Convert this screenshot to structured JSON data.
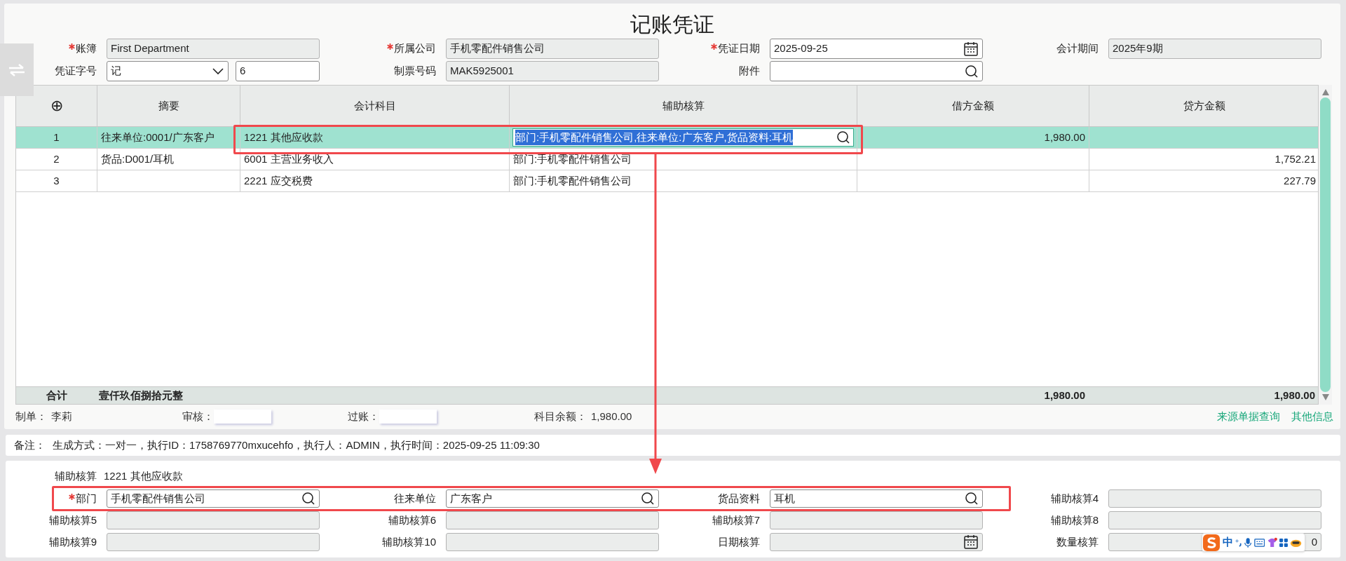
{
  "window": {
    "title": "记账凭证"
  },
  "header_fields": [
    {
      "label": "账簿",
      "required": true,
      "kind": "text",
      "readonly": true,
      "value": "First Department"
    },
    {
      "label": "所属公司",
      "required": true,
      "kind": "text",
      "readonly": true,
      "value": "手机零配件销售公司"
    },
    {
      "label": "凭证日期",
      "required": true,
      "kind": "date",
      "readonly": false,
      "value": "2025-09-25"
    },
    {
      "label": "会计期间",
      "required": false,
      "kind": "text",
      "readonly": true,
      "value": "2025年9期"
    },
    {
      "label": "凭证字号",
      "required": false,
      "kind": "select_pair",
      "readonly": false,
      "value": "记",
      "second_value": "6"
    },
    {
      "label": "制票号码",
      "required": false,
      "kind": "text",
      "readonly": true,
      "value": "MAK5925001"
    },
    {
      "label": "附件",
      "required": false,
      "kind": "lookup",
      "readonly": false
    }
  ],
  "table": {
    "add_column": "⊕",
    "columns": [
      "摘要",
      "会计科目",
      "辅助核算",
      "借方金额",
      "贷方金额"
    ],
    "rows": [
      {
        "index": "1",
        "selected": true,
        "summary": "往来单位:0001/广东客户",
        "account": "1221 其他应收款",
        "auxiliary": "部门:手机零配件销售公司,往来单位:广东客户,货品资料:耳机",
        "debit": "1,980.00"
      },
      {
        "index": "2",
        "selected": false,
        "summary": "货品:D001/耳机",
        "account": "6001 主营业务收入",
        "auxiliary": "部门:手机零配件销售公司",
        "credit": "1,752.21"
      },
      {
        "index": "3",
        "selected": false,
        "account": "2221 应交税费",
        "auxiliary": "部门:手机零配件销售公司",
        "credit": "227.79"
      }
    ],
    "total": {
      "label": "合计",
      "amount_in_words": "壹仟玖佰捌拾元整",
      "debit": "1,980.00",
      "credit": "1,980.00"
    }
  },
  "footer": {
    "maker_label": "制单：",
    "maker": "李莉",
    "reviewer_label": "审核：",
    "posting_label": "过账：",
    "balance_label": "科目余额：",
    "balance": "1,980.00",
    "links": [
      "来源单据查询",
      "其他信息"
    ]
  },
  "remark": {
    "label": "备注：",
    "text": "生成方式：一对一，执行ID：1758769770mxucehfo，执行人：ADMIN，执行时间：2025-09-25 11:09:30"
  },
  "auxiliary_panel": {
    "label": "辅助核算",
    "account": "1221 其他应收款",
    "fields": [
      {
        "label": "部门",
        "required": true,
        "kind": "lookup",
        "readonly": false,
        "value": "手机零配件销售公司"
      },
      {
        "label": "往来单位",
        "required": false,
        "kind": "lookup",
        "readonly": false,
        "value": "广东客户"
      },
      {
        "label": "货品资料",
        "required": false,
        "kind": "lookup",
        "readonly": false,
        "value": "耳机"
      },
      {
        "label": "辅助核算4",
        "required": false,
        "kind": "text",
        "readonly": true
      },
      {
        "label": "辅助核算5",
        "required": false,
        "kind": "text",
        "readonly": true
      },
      {
        "label": "辅助核算6",
        "required": false,
        "kind": "text",
        "readonly": true
      },
      {
        "label": "辅助核算7",
        "required": false,
        "kind": "text",
        "readonly": true
      },
      {
        "label": "辅助核算8",
        "required": false,
        "kind": "text",
        "readonly": true
      },
      {
        "label": "辅助核算9",
        "required": false,
        "kind": "text",
        "readonly": true
      },
      {
        "label": "辅助核算10",
        "required": false,
        "kind": "text",
        "readonly": true
      },
      {
        "label": "日期核算",
        "required": false,
        "kind": "date",
        "readonly": true
      },
      {
        "label": "数量核算",
        "required": false,
        "kind": "number",
        "readonly": true,
        "value": "0"
      }
    ]
  },
  "ime_toolbar": {
    "mode": "中"
  }
}
